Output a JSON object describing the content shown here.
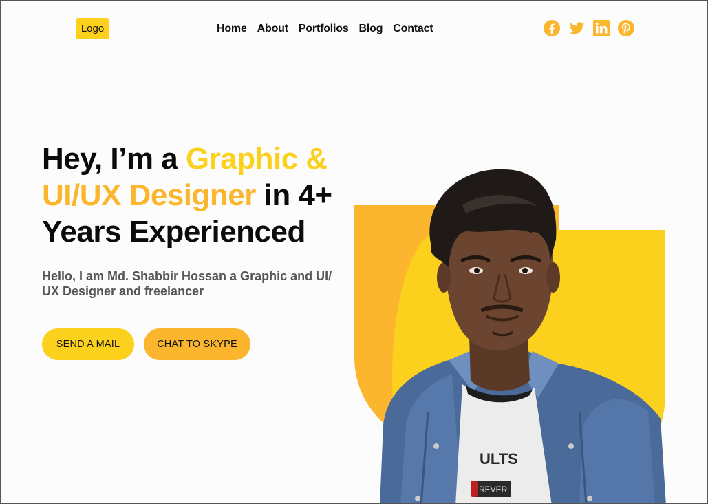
{
  "header": {
    "logo_label": "Logo",
    "nav": [
      "Home",
      "About",
      "Portfolios",
      "Blog",
      "Contact"
    ],
    "social_icons": [
      "facebook-icon",
      "twitter-icon",
      "linkedin-icon",
      "pinterest-icon"
    ]
  },
  "hero": {
    "headline_part1": "Hey, I’m a ",
    "headline_highlight1": "Graphic &",
    "headline_highlight2": "UI/UX Designer",
    "headline_part2": " in 4+",
    "headline_part3": "Years Experienced",
    "intro": "Hello, I am Md. Shabbir Hossan a Graphic and UI/ UX Designer and freelancer",
    "btn_mail": "SEND A MAIL",
    "btn_skype": "CHAT TO SKYPE",
    "portrait_shirt_text": "ULTS",
    "portrait_shirt_badge": "REVER"
  },
  "colors": {
    "accent_yellow": "#fbd11d",
    "accent_orange": "#fbb62d",
    "text_dark": "#0b0b0b",
    "text_muted": "#555555"
  }
}
